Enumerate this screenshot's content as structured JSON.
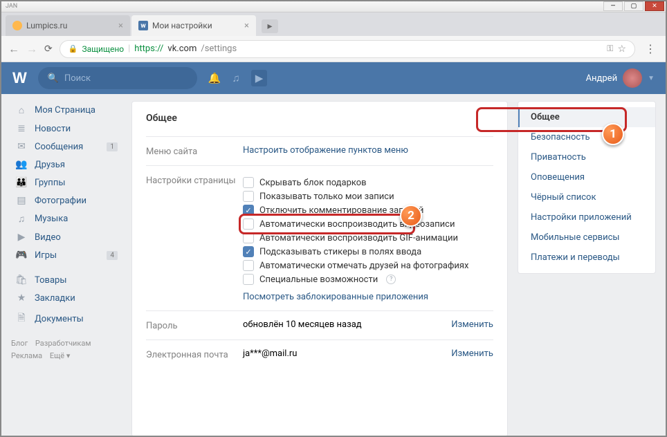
{
  "window": {
    "user": "JAN"
  },
  "tabs": [
    {
      "title": "Lumpics.ru",
      "active": false
    },
    {
      "title": "Мои настройки",
      "active": true
    }
  ],
  "urlbar": {
    "secure_label": "Защищено",
    "scheme": "https://",
    "host": "vk.com",
    "path": "/settings"
  },
  "vk_header": {
    "search_placeholder": "Поиск",
    "username": "Андрей"
  },
  "left_nav": {
    "items": [
      {
        "icon": "⌂",
        "label": "Моя Страница"
      },
      {
        "icon": "≣",
        "label": "Новости"
      },
      {
        "icon": "✉",
        "label": "Сообщения",
        "badge": "1"
      },
      {
        "icon": "👥",
        "label": "Друзья"
      },
      {
        "icon": "👪",
        "label": "Группы"
      },
      {
        "icon": "▤",
        "label": "Фотографии"
      },
      {
        "icon": "♫",
        "label": "Музыка"
      },
      {
        "icon": "▶",
        "label": "Видео"
      },
      {
        "icon": "🎮",
        "label": "Игры",
        "badge": "4"
      }
    ],
    "items2": [
      {
        "icon": "🛍",
        "label": "Товары"
      },
      {
        "icon": "★",
        "label": "Закладки"
      },
      {
        "icon": "🗎",
        "label": "Документы"
      }
    ],
    "footer": [
      "Блог",
      "Разработчикам",
      "Реклама",
      "Ещё ▾"
    ]
  },
  "main": {
    "title": "Общее",
    "section_menu": {
      "label": "Меню сайта",
      "link": "Настроить отображение пунктов меню"
    },
    "section_page": {
      "label": "Настройки страницы",
      "checks": [
        {
          "label": "Скрывать блок подарков",
          "checked": false
        },
        {
          "label": "Показывать только мои записи",
          "checked": false
        },
        {
          "label": "Отключить комментирование записей",
          "checked": true
        },
        {
          "label": "Автоматически воспроизводить видеозаписи",
          "checked": false
        },
        {
          "label": "Автоматически воспроизводить GIF-анимации",
          "checked": false
        },
        {
          "label": "Подсказывать стикеры в полях ввода",
          "checked": true
        },
        {
          "label": "Автоматически отмечать друзей на фотографиях",
          "checked": false
        },
        {
          "label": "Специальные возможности",
          "checked": false,
          "help": true
        }
      ],
      "blocked_link": "Посмотреть заблокированные приложения"
    },
    "section_password": {
      "label": "Пароль",
      "value": "обновлён 10 месяцев назад",
      "action": "Изменить"
    },
    "section_email": {
      "label": "Электронная почта",
      "value": "ja***@mail.ru",
      "action": "Изменить"
    }
  },
  "right_nav": {
    "items": [
      "Общее",
      "Безопасность",
      "Приватность",
      "Оповещения",
      "Чёрный список",
      "Настройки приложений",
      "Мобильные сервисы",
      "Платежи и переводы"
    ],
    "active_index": 0
  },
  "callouts": {
    "n1": "1",
    "n2": "2"
  }
}
